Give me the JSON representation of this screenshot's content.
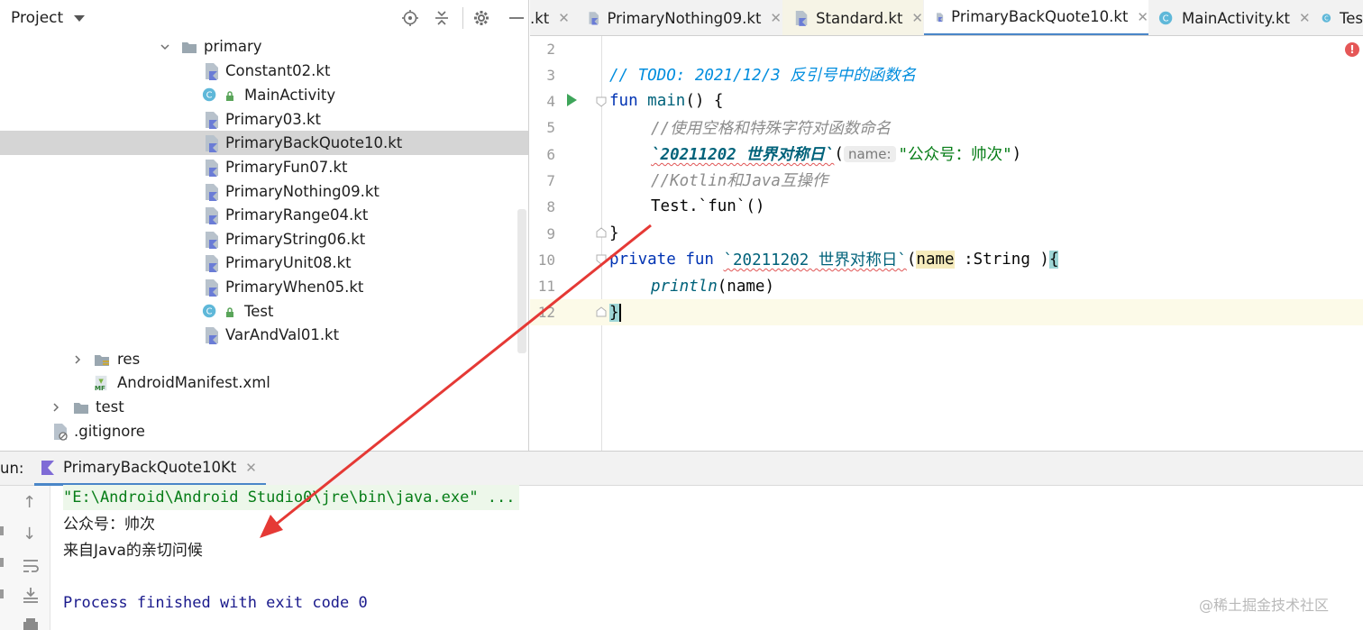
{
  "project_panel": {
    "title": "Project",
    "tree": [
      {
        "label": "primary",
        "kind": "folder",
        "expanded": true
      },
      {
        "label": "Constant02.kt",
        "kind": "kotlin-file"
      },
      {
        "label": "MainActivity",
        "kind": "kotlin-class"
      },
      {
        "label": "Primary03.kt",
        "kind": "kotlin-file"
      },
      {
        "label": "PrimaryBackQuote10.kt",
        "kind": "kotlin-file",
        "selected": true
      },
      {
        "label": "PrimaryFun07.kt",
        "kind": "kotlin-file"
      },
      {
        "label": "PrimaryNothing09.kt",
        "kind": "kotlin-file"
      },
      {
        "label": "PrimaryRange04.kt",
        "kind": "kotlin-file"
      },
      {
        "label": "PrimaryString06.kt",
        "kind": "kotlin-file"
      },
      {
        "label": "PrimaryUnit08.kt",
        "kind": "kotlin-file"
      },
      {
        "label": "PrimaryWhen05.kt",
        "kind": "kotlin-file"
      },
      {
        "label": "Test",
        "kind": "kotlin-class"
      },
      {
        "label": "VarAndVal01.kt",
        "kind": "kotlin-file"
      },
      {
        "label": "res",
        "kind": "res-folder",
        "expanded": false
      },
      {
        "label": "AndroidManifest.xml",
        "kind": "manifest"
      },
      {
        "label": "test",
        "kind": "folder",
        "expanded": false
      },
      {
        "label": ".gitignore",
        "kind": "ignore-file"
      }
    ]
  },
  "tabs": [
    {
      "label": ".kt"
    },
    {
      "label": "PrimaryNothing09.kt"
    },
    {
      "label": "Standard.kt"
    },
    {
      "label": "PrimaryBackQuote10.kt",
      "active": true
    },
    {
      "label": "MainActivity.kt"
    },
    {
      "label": "Tes"
    }
  ],
  "editor": {
    "line_numbers": [
      "2",
      "3",
      "4",
      "5",
      "6",
      "7",
      "8",
      "9",
      "10",
      "11",
      "12"
    ],
    "lines": {
      "l3": {
        "comment": "// TODO: 2021/12/3 反引号中的函数名"
      },
      "l4": {
        "kw": "fun",
        "name": "main",
        "rest": "() {"
      },
      "l5": {
        "comment": "//使用空格和特殊字符对函数命名"
      },
      "l6": {
        "fname": "`20211202 世界对称日`",
        "open": "(",
        "hint": "name:",
        "arg": "\"公众号：帅次\"",
        "close": ")"
      },
      "l7": {
        "comment": "//Kotlin和Java互操作"
      },
      "l8": {
        "code": "Test.`fun`()"
      },
      "l9": {
        "code": "}"
      },
      "l10": {
        "kw1": "private",
        "kw2": "fun",
        "fname": "`20211202 世界对称日`",
        "open": "(",
        "param": "name",
        "rest": " :String )",
        "brace": "{"
      },
      "l11": {
        "call": "println",
        "args": "(name)"
      },
      "l12": {
        "brace": "}"
      }
    }
  },
  "run_panel": {
    "label": "un:",
    "tab": "PrimaryBackQuote10Kt",
    "output": {
      "command": "\"E:\\Android\\Android Studio0\\jre\\bin\\java.exe\" ...",
      "line1": "公众号：帅次",
      "line2": "来自Java的亲切问候",
      "exit": "Process finished with exit code 0"
    }
  },
  "watermark": "@稀土掘金技术社区",
  "colors": {
    "keyword": "#0033b3",
    "function": "#00627a",
    "string": "#067d17",
    "todo": "#008dde",
    "comment": "#8c8c8c",
    "arrow": "#e53935",
    "tab_underline": "#4a86c8"
  }
}
